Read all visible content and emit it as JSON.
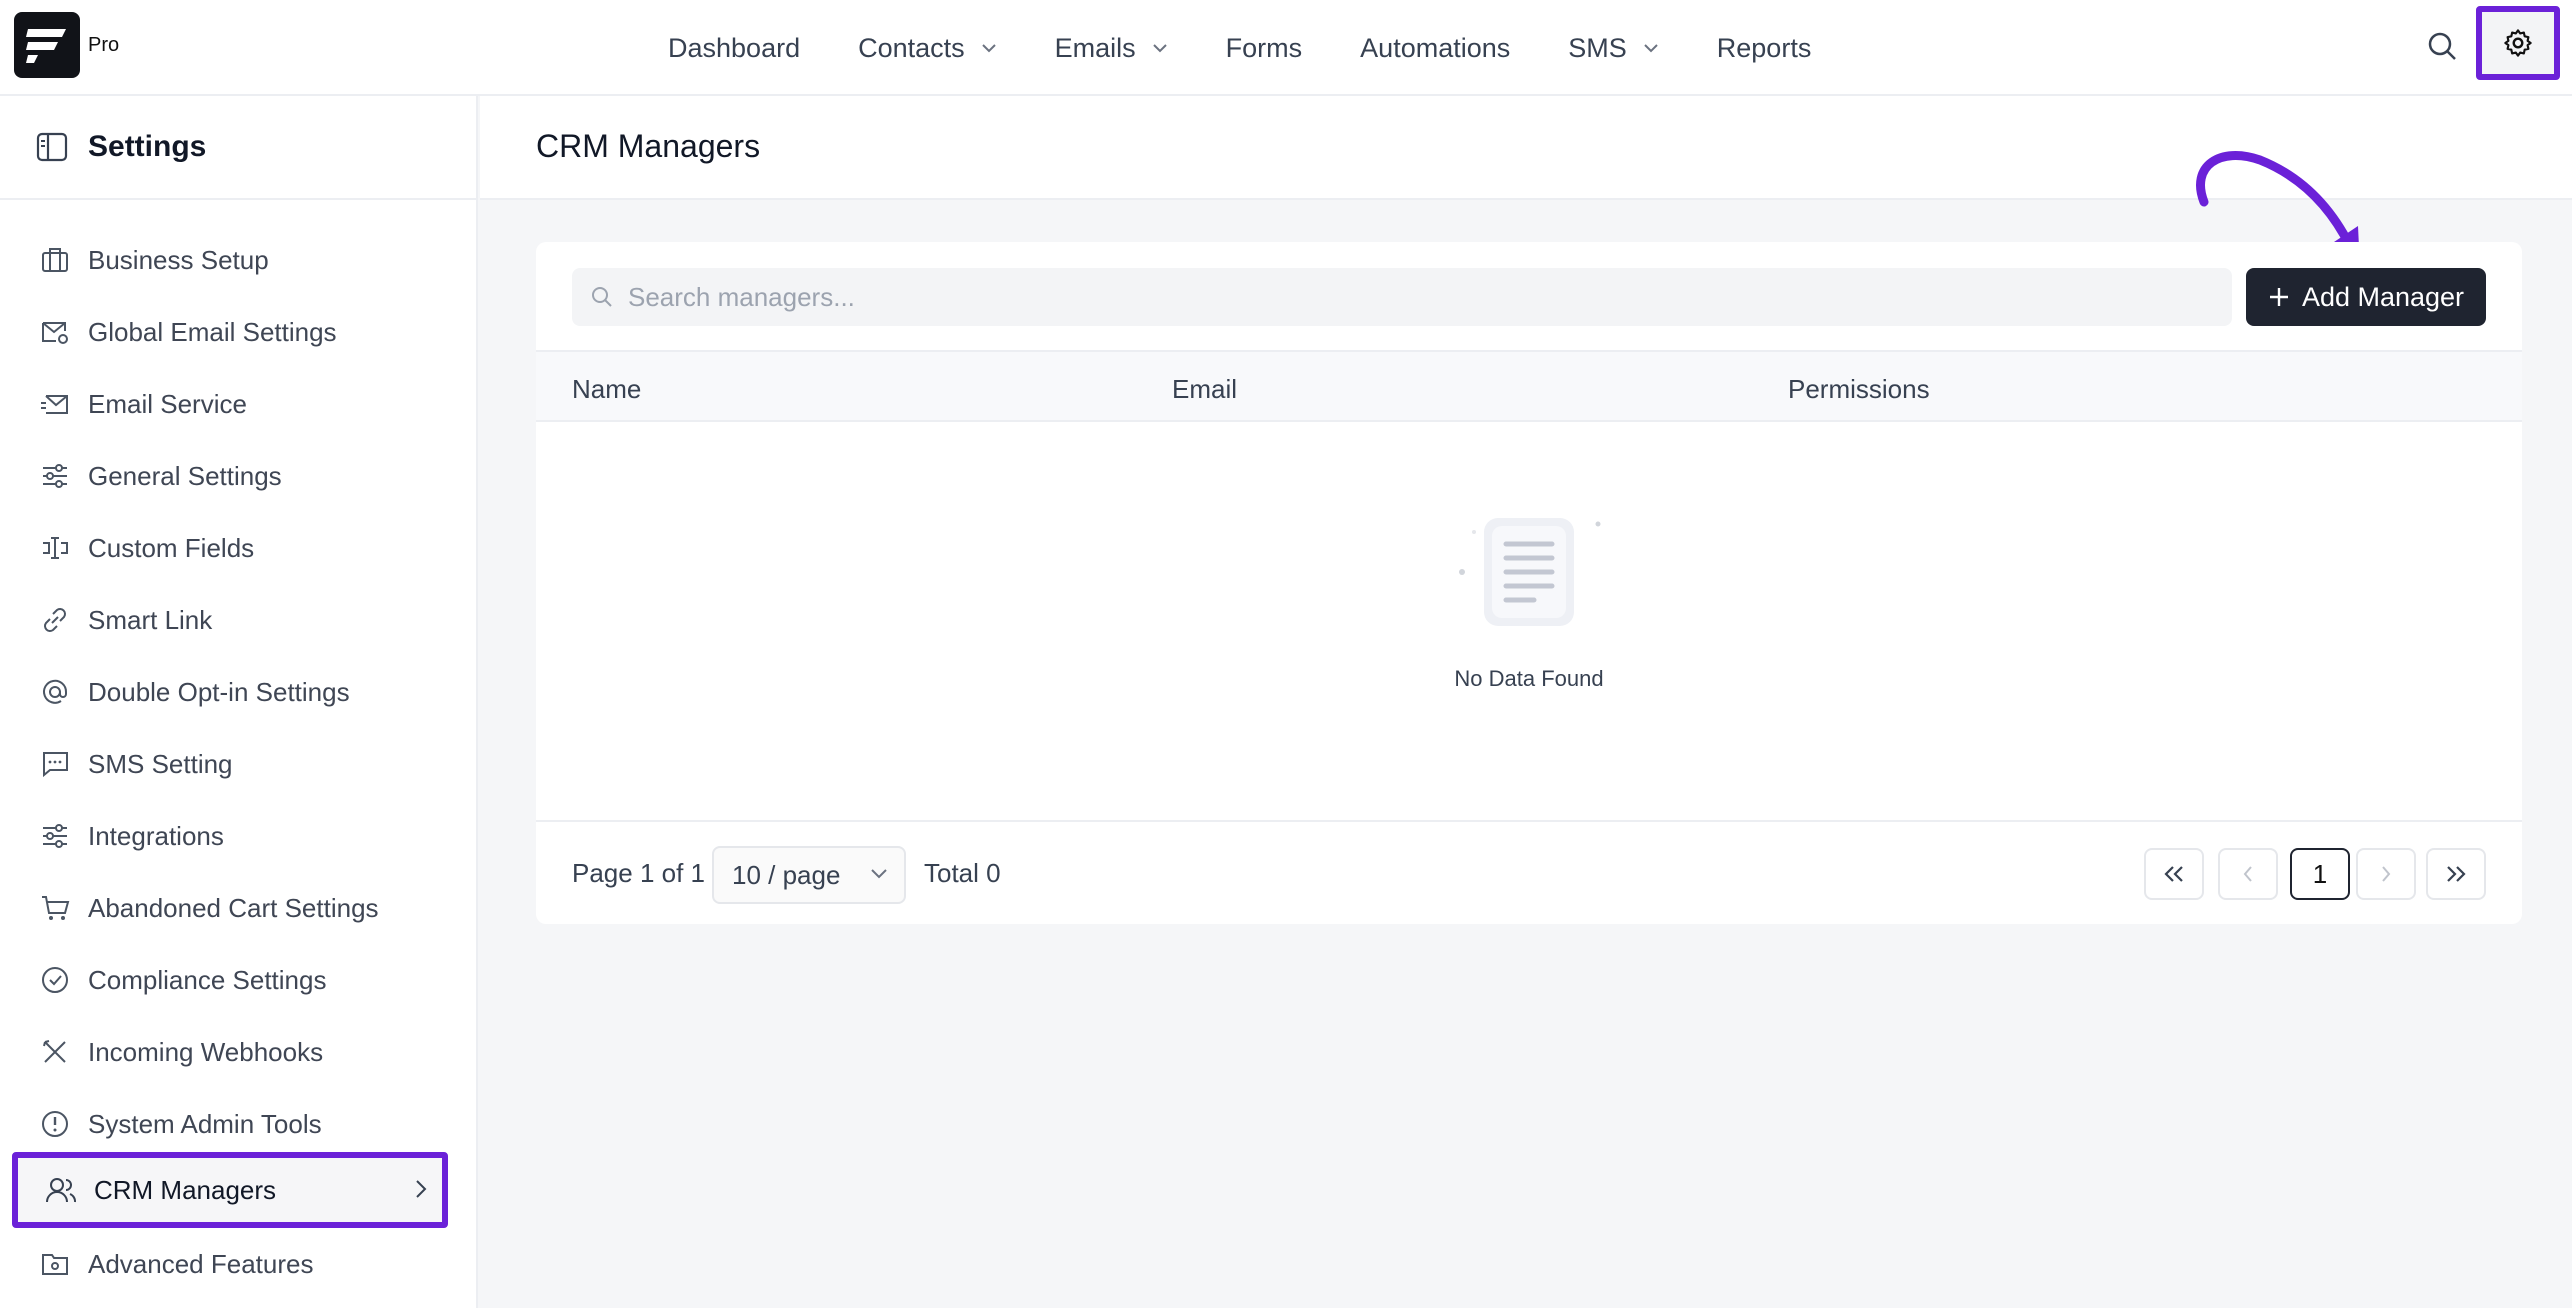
{
  "app": {
    "badge": "Pro"
  },
  "nav": {
    "items": [
      {
        "label": "Dashboard",
        "has_dropdown": false
      },
      {
        "label": "Contacts",
        "has_dropdown": true
      },
      {
        "label": "Emails",
        "has_dropdown": true
      },
      {
        "label": "Forms",
        "has_dropdown": false
      },
      {
        "label": "Automations",
        "has_dropdown": false
      },
      {
        "label": "SMS",
        "has_dropdown": true
      },
      {
        "label": "Reports",
        "has_dropdown": false
      }
    ],
    "search_icon": "search-icon",
    "settings_icon": "gear-icon"
  },
  "sidebar": {
    "title": "Settings",
    "items": [
      {
        "label": "Business Setup",
        "icon": "briefcase-icon"
      },
      {
        "label": "Global Email Settings",
        "icon": "mail-settings-icon"
      },
      {
        "label": "Email Service",
        "icon": "mail-send-icon"
      },
      {
        "label": "General Settings",
        "icon": "sliders-icon"
      },
      {
        "label": "Custom Fields",
        "icon": "text-cursor-icon"
      },
      {
        "label": "Smart Link",
        "icon": "link-icon"
      },
      {
        "label": "Double Opt-in Settings",
        "icon": "at-sign-icon"
      },
      {
        "label": "SMS Setting",
        "icon": "message-icon"
      },
      {
        "label": "Integrations",
        "icon": "sliders-icon"
      },
      {
        "label": "Abandoned Cart Settings",
        "icon": "cart-icon"
      },
      {
        "label": "Compliance Settings",
        "icon": "check-circle-icon"
      },
      {
        "label": "Incoming Webhooks",
        "icon": "tools-icon"
      },
      {
        "label": "System Admin Tools",
        "icon": "alert-circle-icon"
      },
      {
        "label": "CRM Managers",
        "icon": "users-icon",
        "active": true
      },
      {
        "label": "Advanced Features",
        "icon": "folder-gear-icon"
      }
    ]
  },
  "main": {
    "title": "CRM Managers",
    "search_placeholder": "Search managers...",
    "add_button": "Add Manager",
    "columns": [
      "Name",
      "Email",
      "Permissions"
    ],
    "empty_text": "No Data Found",
    "pagination": {
      "page_info": "Page 1 of 1",
      "per_page": "10 / page",
      "total": "Total 0",
      "current_page": "1"
    }
  },
  "colors": {
    "highlight": "#6b21d8",
    "dark_button": "#1f2430"
  }
}
